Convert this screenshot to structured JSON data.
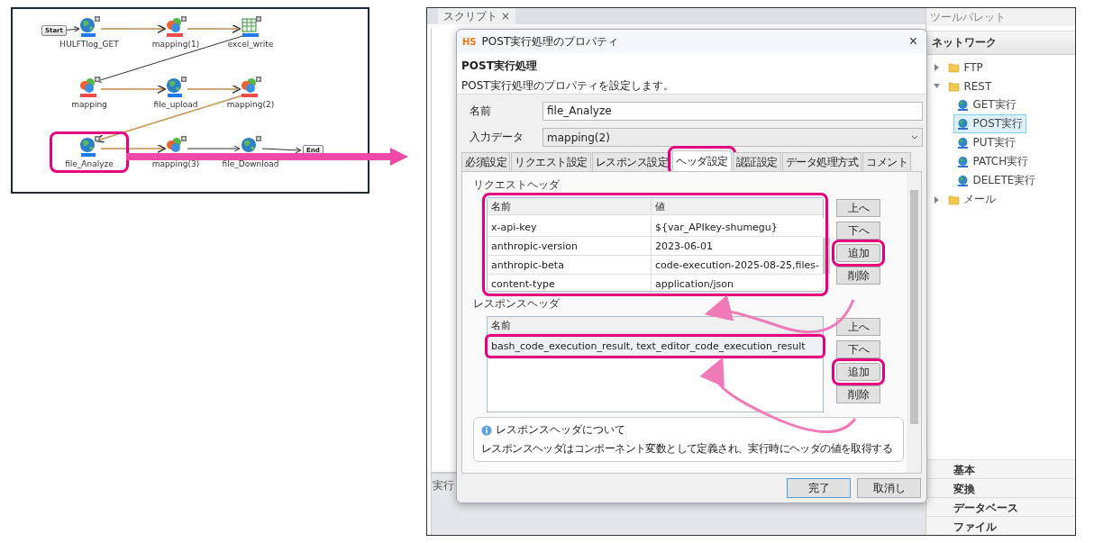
{
  "diagram": {
    "nodes": [
      {
        "kind": "start",
        "label": "Start",
        "highlighted": false
      },
      {
        "kind": "rest",
        "label": "HULFTlog_GET",
        "highlighted": false
      },
      {
        "kind": "mapper",
        "label": "mapping(1)",
        "highlighted": false
      },
      {
        "kind": "excel",
        "label": "excel_write",
        "highlighted": false
      },
      {
        "kind": "mapper",
        "label": "mapping",
        "highlighted": false
      },
      {
        "kind": "rest",
        "label": "file_upload",
        "highlighted": false
      },
      {
        "kind": "mapper",
        "label": "mapping(2)",
        "highlighted": false
      },
      {
        "kind": "rest",
        "label": "file_Analyze",
        "highlighted": true
      },
      {
        "kind": "mapper",
        "label": "mapping(3)",
        "highlighted": false
      },
      {
        "kind": "rest",
        "label": "file_Download",
        "highlighted": false
      },
      {
        "kind": "end",
        "label": "End",
        "highlighted": false
      }
    ]
  },
  "ide": {
    "tab": {
      "label": "スクリプト",
      "close": "×"
    },
    "bottom_tab": "実行"
  },
  "dialog": {
    "logo": "HS",
    "title": "POST実行処理のプロパティ",
    "close": "×",
    "heading": "POST実行処理",
    "description": "POST実行処理のプロパティを設定します。",
    "fields": [
      {
        "kind": "text",
        "label": "名前",
        "value": "file_Analyze"
      },
      {
        "kind": "select",
        "label": "入力データ",
        "value": "mapping(2)"
      }
    ],
    "tabs": [
      {
        "label": "必須設定",
        "selected": false,
        "highlighted": false
      },
      {
        "label": "リクエスト設定",
        "selected": false,
        "highlighted": false
      },
      {
        "label": "レスポンス設定",
        "selected": false,
        "highlighted": false
      },
      {
        "label": "ヘッダ設定",
        "selected": true,
        "highlighted": true
      },
      {
        "label": "認証設定",
        "selected": false,
        "highlighted": false
      },
      {
        "label": "データ処理方式",
        "selected": false,
        "highlighted": false
      },
      {
        "label": "コメント",
        "selected": false,
        "highlighted": false
      }
    ],
    "request_headers": {
      "title": "リクエストヘッダ",
      "highlighted": true,
      "columns": [
        "名前",
        "値"
      ],
      "rows": [
        {
          "name": "x-api-key",
          "value": "${var_APIkey-shumegu}"
        },
        {
          "name": "anthropic-version",
          "value": "2023-06-01"
        },
        {
          "name": "anthropic-beta",
          "value": "code-execution-2025-08-25,files-"
        },
        {
          "name": "content-type",
          "value": "application/json"
        }
      ],
      "buttons": [
        {
          "label": "上へ",
          "highlighted": false
        },
        {
          "label": "下へ",
          "highlighted": false
        },
        {
          "label": "追加",
          "highlighted": true
        },
        {
          "label": "削除",
          "highlighted": false
        }
      ]
    },
    "response_headers": {
      "title": "レスポンスヘッダ",
      "columns": [
        "名前"
      ],
      "rows": [
        {
          "name": "bash_code_execution_result, text_editor_code_execution_result",
          "highlighted": true
        }
      ],
      "buttons": [
        {
          "label": "上へ",
          "highlighted": false
        },
        {
          "label": "下へ",
          "highlighted": false
        },
        {
          "label": "追加",
          "highlighted": true
        },
        {
          "label": "削除",
          "highlighted": false
        }
      ]
    },
    "info": {
      "title": "レスポンスヘッダについて",
      "text": "レスポンスヘッダはコンポーネント変数として定義され、実行時にヘッダの値を取得する"
    },
    "buttons": [
      "完了",
      "取消し"
    ]
  },
  "palette": {
    "title": "ツールパレット",
    "section": "ネットワーク",
    "tree": [
      {
        "label": "FTP",
        "expanded": false
      },
      {
        "label": "REST",
        "expanded": true,
        "children": [
          {
            "label": "GET実行",
            "selected": false
          },
          {
            "label": "POST実行",
            "selected": true
          },
          {
            "label": "PUT実行",
            "selected": false
          },
          {
            "label": "PATCH実行",
            "selected": false
          },
          {
            "label": "DELETE実行",
            "selected": false
          }
        ]
      },
      {
        "label": "メール",
        "expanded": false
      }
    ],
    "categories": [
      "基本",
      "変換",
      "データベース",
      "ファイル"
    ]
  }
}
